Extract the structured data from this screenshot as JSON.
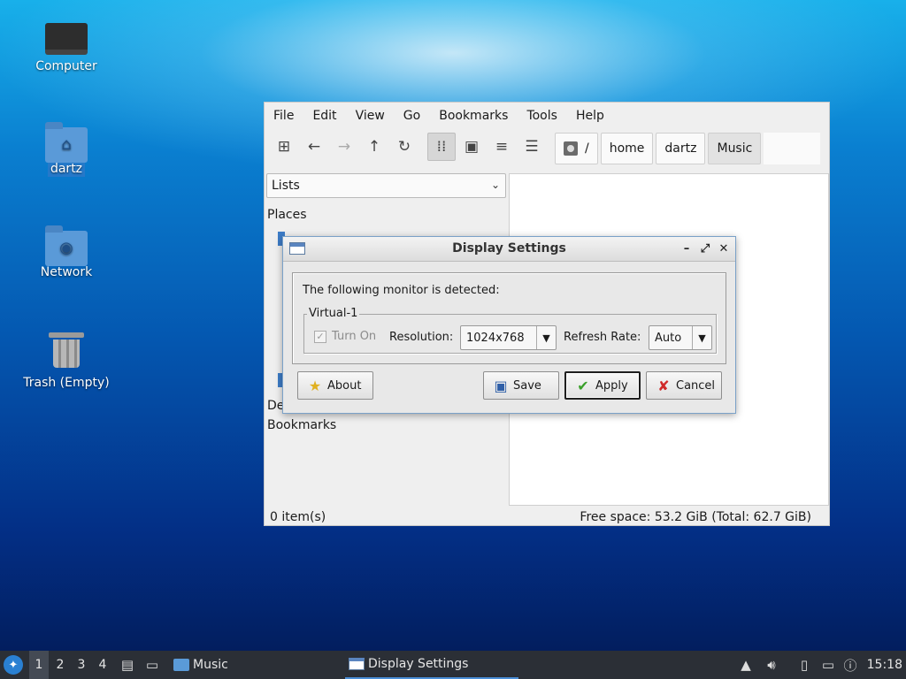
{
  "desktop": {
    "icons": [
      {
        "label": "Computer"
      },
      {
        "label": "dartz"
      },
      {
        "label": "Network"
      },
      {
        "label": "Trash (Empty)"
      }
    ]
  },
  "file_manager": {
    "menu": [
      "File",
      "Edit",
      "View",
      "Go",
      "Bookmarks",
      "Tools",
      "Help"
    ],
    "toolbar_icons": [
      "new-tab-icon",
      "back-arrow-icon",
      "forward-arrow-icon",
      "up-arrow-icon",
      "reload-icon",
      "icon-view-icon",
      "thumbnail-view-icon",
      "compact-view-icon",
      "detailed-list-icon"
    ],
    "path": [
      "/",
      "home",
      "dartz",
      "Music"
    ],
    "side_pane_mode": "Lists",
    "side_headings": {
      "places": "Places",
      "devices_partial": "De",
      "bookmarks": "Bookmarks"
    },
    "status": {
      "items": "0 item(s)",
      "free_space": "Free space: 53.2 GiB (Total: 62.7 GiB)"
    }
  },
  "dialog": {
    "title": "Display Settings",
    "detected_text": "The following monitor is detected:",
    "monitor_name": "Virtual-1",
    "turn_on_label": "Turn On",
    "resolution_label": "Resolution:",
    "resolution_value": "1024x768",
    "refresh_label": "Refresh Rate:",
    "refresh_value": "Auto",
    "buttons": {
      "about": "About",
      "save": "Save",
      "apply": "Apply",
      "cancel": "Cancel"
    }
  },
  "taskbar": {
    "workspaces": [
      "1",
      "2",
      "3",
      "4"
    ],
    "active_workspace": "1",
    "tasks": [
      {
        "label": "Music"
      },
      {
        "label": "Display Settings"
      }
    ],
    "clock": "15:18"
  },
  "colors": {
    "taskbar_bg": "#2b2f36",
    "accent": "#4a8ed8",
    "folder": "#5a9ad8"
  }
}
